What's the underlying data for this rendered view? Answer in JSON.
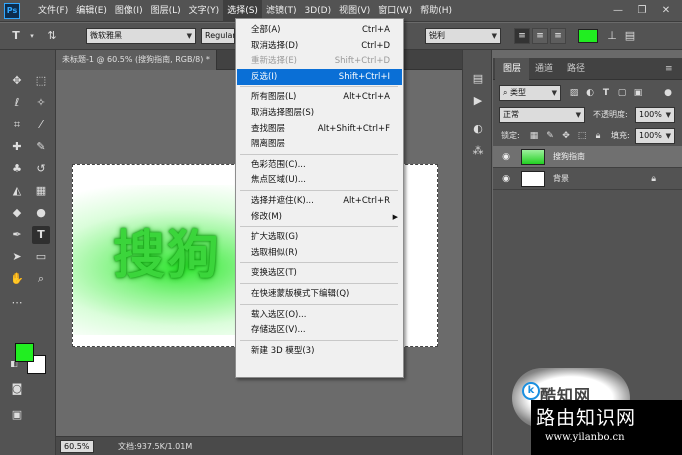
{
  "app": {
    "logo": "Ps"
  },
  "menubar": {
    "items": [
      "文件(F)",
      "编辑(E)",
      "图像(I)",
      "图层(L)",
      "文字(Y)",
      "选择(S)",
      "滤镜(T)",
      "3D(D)",
      "视图(V)",
      "窗口(W)",
      "帮助(H)"
    ],
    "active_index": 5,
    "window_controls": [
      "—",
      "❐",
      "✕"
    ]
  },
  "options_bar": {
    "tool_icon": "T",
    "font_family": "微软雅黑",
    "font_style": "Regular",
    "antialias": "锐利",
    "color": "#21ee21"
  },
  "document": {
    "tab_title": "未标题-1 @ 60.5% (搜狗指南, RGB/8) *",
    "canvas_text": "搜狗",
    "zoom": "60.5%",
    "doc_size": "文档:937.5K/1.01M"
  },
  "toolbox": {
    "foreground_color": "#21ee21",
    "background_color": "#ffffff"
  },
  "select_menu": {
    "items": [
      {
        "label": "全部(A)",
        "shortcut": "Ctrl+A",
        "state": "normal"
      },
      {
        "label": "取消选择(D)",
        "shortcut": "Ctrl+D",
        "state": "normal"
      },
      {
        "label": "重新选择(E)",
        "shortcut": "Shift+Ctrl+D",
        "state": "disabled"
      },
      {
        "label": "反选(I)",
        "shortcut": "Shift+Ctrl+I",
        "state": "highlighted"
      },
      {
        "sep": true
      },
      {
        "label": "所有图层(L)",
        "shortcut": "Alt+Ctrl+A",
        "state": "normal"
      },
      {
        "label": "取消选择图层(S)",
        "shortcut": "",
        "state": "normal"
      },
      {
        "label": "查找图层",
        "shortcut": "Alt+Shift+Ctrl+F",
        "state": "normal"
      },
      {
        "label": "隔离图层",
        "shortcut": "",
        "state": "normal"
      },
      {
        "sep": true
      },
      {
        "label": "色彩范围(C)...",
        "shortcut": "",
        "state": "normal"
      },
      {
        "label": "焦点区域(U)...",
        "shortcut": "",
        "state": "normal"
      },
      {
        "sep": true
      },
      {
        "label": "选择并遮住(K)...",
        "shortcut": "Alt+Ctrl+R",
        "state": "normal"
      },
      {
        "label": "修改(M)",
        "shortcut": "",
        "state": "normal",
        "submenu": true
      },
      {
        "sep": true
      },
      {
        "label": "扩大选取(G)",
        "shortcut": "",
        "state": "normal"
      },
      {
        "label": "选取相似(R)",
        "shortcut": "",
        "state": "normal"
      },
      {
        "sep": true
      },
      {
        "label": "变换选区(T)",
        "shortcut": "",
        "state": "normal"
      },
      {
        "sep": true
      },
      {
        "label": "在快速蒙版模式下编辑(Q)",
        "shortcut": "",
        "state": "normal"
      },
      {
        "sep": true
      },
      {
        "label": "载入选区(O)...",
        "shortcut": "",
        "state": "normal"
      },
      {
        "label": "存储选区(V)...",
        "shortcut": "",
        "state": "normal"
      },
      {
        "sep": true
      },
      {
        "label": "新建 3D 模型(3)",
        "shortcut": "",
        "state": "normal"
      }
    ]
  },
  "layers_panel": {
    "tabs": [
      "图层",
      "通道",
      "路径"
    ],
    "active_tab": 0,
    "filter_kind": "类型",
    "blend_mode": "正常",
    "opacity_label": "不透明度:",
    "opacity_value": "100%",
    "lock_label": "锁定:",
    "fill_label": "填充:",
    "fill_value": "100%",
    "layers": [
      {
        "name": "搜狗指南",
        "selected": true,
        "locked": false
      },
      {
        "name": "背景",
        "selected": false,
        "locked": true
      }
    ]
  },
  "watermark": {
    "logo_text": "酷知网",
    "logo_letter": "k",
    "title": "路由知识网",
    "url": "www.yilanbo.cn"
  }
}
